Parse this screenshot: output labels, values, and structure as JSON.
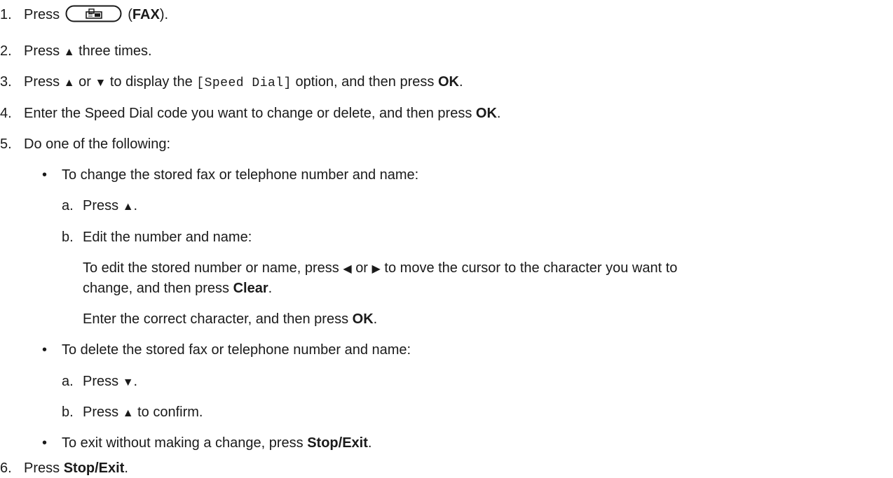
{
  "steps": {
    "s1": {
      "num": "1.",
      "press": "Press",
      "open_paren": "(",
      "fax": "FAX",
      "close": ")."
    },
    "s2": {
      "num": "2.",
      "press": "Press",
      "up": "▲",
      "rest": "three times."
    },
    "s3": {
      "num": "3.",
      "press": "Press",
      "up": "▲",
      "or": "or",
      "down": "▼",
      "text1": "to display the",
      "code": "[Speed Dial]",
      "text2": "option, and then press",
      "ok": "OK",
      "dot": "."
    },
    "s4": {
      "num": "4.",
      "text": "Enter the Speed Dial code you want to change or delete, and then press",
      "ok": "OK",
      "dot": "."
    },
    "s5": {
      "num": "5.",
      "text": "Do one of the following:"
    },
    "s6": {
      "num": "6.",
      "press": "Press",
      "stop": "Stop/Exit",
      "dot": "."
    }
  },
  "options": {
    "change": {
      "bullet": "•",
      "text": "To change the stored fax or telephone number and name:",
      "a": {
        "label": "a.",
        "press": "Press",
        "up": "▲",
        "dot": "."
      },
      "b": {
        "label": "b.",
        "text": "Edit the number and name:",
        "p1_start": "To edit the stored number or name, press",
        "left": "◀",
        "or": "or",
        "right": "▶",
        "p1_end": "to move the cursor to the character you want to",
        "p1_line2": "change, and then press",
        "clear": "Clear",
        "dot": ".",
        "p2": "Enter the correct character, and then press",
        "ok": "OK"
      }
    },
    "delete": {
      "bullet": "•",
      "text": "To delete the stored fax or telephone number and name:",
      "a": {
        "label": "a.",
        "press": "Press",
        "down": "▼",
        "dot": "."
      },
      "b": {
        "label": "b.",
        "press": "Press",
        "up": "▲",
        "rest": "to confirm."
      }
    },
    "exit": {
      "bullet": "•",
      "text": "To exit without making a change, press",
      "stop": "Stop/Exit",
      "dot": "."
    }
  }
}
